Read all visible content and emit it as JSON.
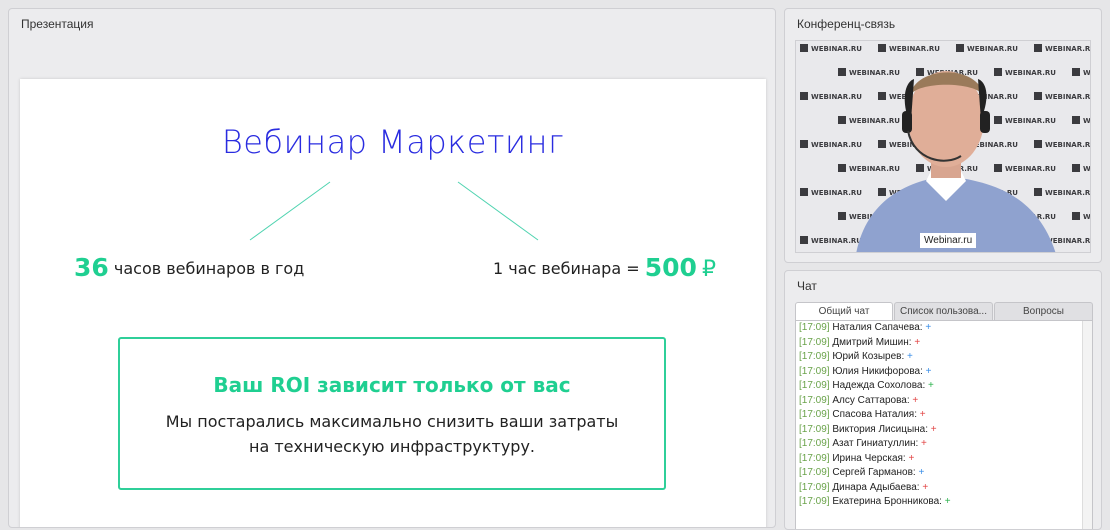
{
  "presentation": {
    "title": "Презентация",
    "slide": {
      "heading": "Вебинар Маркетинг",
      "left_stat_number": "36",
      "left_stat_text": " часов вебинаров в год",
      "right_stat_text": "1 час вебинара = ",
      "right_stat_number": "500",
      "currency": "₽",
      "roi_title": "Ваш ROI зависит только от вас",
      "roi_line1": "Мы постарались максимально снизить ваши затраты",
      "roi_line2": "на техническую инфраструктуру."
    }
  },
  "conference": {
    "title": "Конференц-связь",
    "video_label": "Webinar.ru",
    "backdrop_text": "WEBINAR.RU"
  },
  "chat": {
    "title": "Чат",
    "tabs": [
      "Общий чат",
      "Список пользова...",
      "Вопросы"
    ],
    "messages": [
      {
        "time": "[17:09]",
        "name": "Наталия Сапачева:",
        "plus": "+",
        "color": "blue"
      },
      {
        "time": "[17:09]",
        "name": "Дмитрий Мишин:",
        "plus": "+",
        "color": "red"
      },
      {
        "time": "[17:09]",
        "name": "Юрий Козырев:",
        "plus": "+",
        "color": "blue"
      },
      {
        "time": "[17:09]",
        "name": "Юлия Никифорова:",
        "plus": "+",
        "color": "blue"
      },
      {
        "time": "[17:09]",
        "name": "Надежда Сохолова:",
        "plus": "+",
        "color": "green"
      },
      {
        "time": "[17:09]",
        "name": "Алсу Саттарова:",
        "plus": "+",
        "color": "red"
      },
      {
        "time": "[17:09]",
        "name": "Спасова Наталия:",
        "plus": "+",
        "color": "red"
      },
      {
        "time": "[17:09]",
        "name": "Виктория Лисицына:",
        "plus": "+",
        "color": "red"
      },
      {
        "time": "[17:09]",
        "name": "Азат Гиниатуллин:",
        "plus": "+",
        "color": "red"
      },
      {
        "time": "[17:09]",
        "name": "Ирина Черская:",
        "plus": "+",
        "color": "red"
      },
      {
        "time": "[17:09]",
        "name": "Сергей Гарманов:",
        "plus": "+",
        "color": "blue"
      },
      {
        "time": "[17:09]",
        "name": "Динара Адыбаева:",
        "plus": "+",
        "color": "red"
      },
      {
        "time": "[17:09]",
        "name": "Екатерина Бронникова:",
        "plus": "+",
        "color": "green"
      }
    ]
  },
  "colors": {
    "heading_blue": "#2a2ce0",
    "accent_green": "#1fcf91",
    "timestamp_green": "#6aa34a"
  }
}
